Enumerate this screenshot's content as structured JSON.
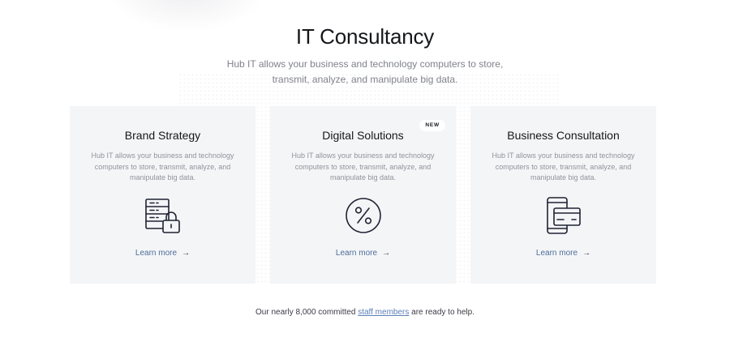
{
  "header": {
    "title": "IT Consultancy",
    "subtitle": "Hub IT allows your business and technology computers to store, transmit, analyze, and manipulate big data."
  },
  "cards": [
    {
      "title": "Brand Strategy",
      "description": "Hub IT allows your business and technology computers to store, transmit, analyze, and manipulate big data.",
      "icon": "server-lock-icon",
      "link_label": "Learn more"
    },
    {
      "title": "Digital Solutions",
      "badge": "NEW",
      "description": "Hub IT allows your business and technology computers to store, transmit, analyze, and manipulate big data.",
      "icon": "percent-icon",
      "link_label": "Learn more"
    },
    {
      "title": "Business Consultation",
      "description": "Hub IT allows your business and technology computers to store, transmit, analyze, and manipulate big data.",
      "icon": "mobile-card-icon",
      "link_label": "Learn more"
    }
  ],
  "footer": {
    "text_before": "Our nearly 8,000 committed",
    "link_label": "staff members",
    "text_after": "are ready to help."
  },
  "colors": {
    "card_background": "#f4f5f7",
    "link": "#4d6d9a",
    "footer_link": "#5b7fb8",
    "text_primary": "#15171a",
    "text_muted": "#80838c"
  }
}
